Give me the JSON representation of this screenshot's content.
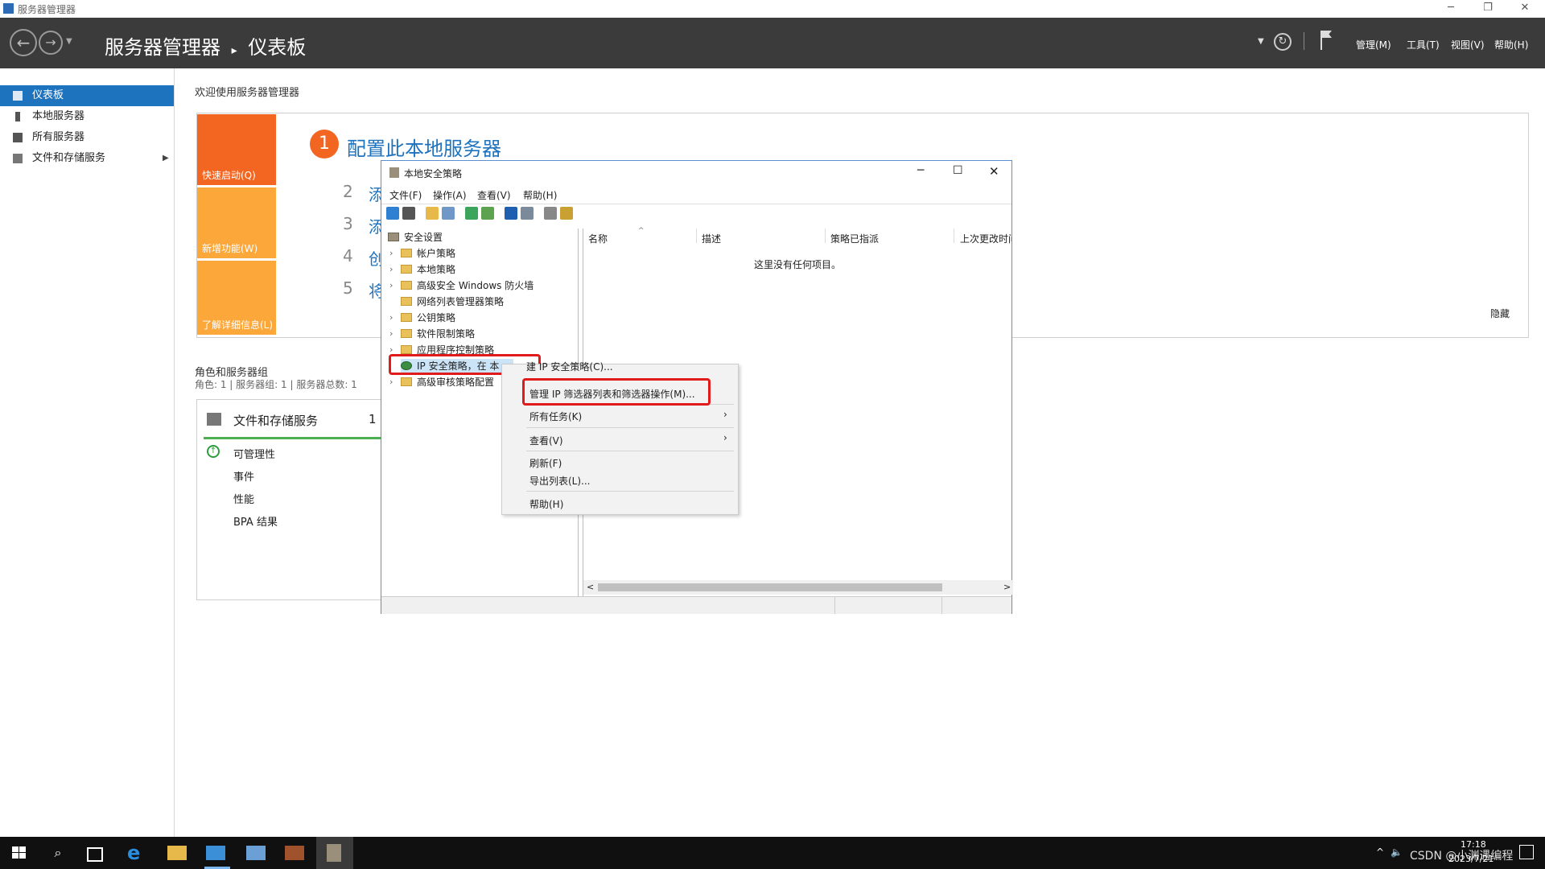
{
  "window": {
    "title": "服务器管理器",
    "controls": [
      "─",
      "❐",
      "✕"
    ]
  },
  "header": {
    "breadcrumb_root": "服务器管理器",
    "breadcrumb_sep": "▸",
    "breadcrumb_page": "仪表板",
    "menus": [
      "管理(M)",
      "工具(T)",
      "视图(V)",
      "帮助(H)"
    ]
  },
  "sidebar": {
    "items": [
      {
        "label": "仪表板",
        "icon": "dashboard-icon",
        "active": true
      },
      {
        "label": "本地服务器",
        "icon": "server-icon"
      },
      {
        "label": "所有服务器",
        "icon": "servers-icon"
      },
      {
        "label": "文件和存储服务",
        "icon": "storage-icon",
        "has_arrow": true
      }
    ]
  },
  "welcome": {
    "title": "欢迎使用服务器管理器",
    "tiles": [
      "快速启动(Q)",
      "新增功能(W)",
      "了解详细信息(L)"
    ],
    "step1": {
      "num": "1",
      "label": "配置此本地服务器"
    },
    "steps": [
      {
        "num": "2",
        "label": "添"
      },
      {
        "num": "3",
        "label": "添"
      },
      {
        "num": "4",
        "label": "创"
      },
      {
        "num": "5",
        "label": "将"
      }
    ],
    "hide": "隐藏"
  },
  "roles": {
    "title": "角色和服务器组",
    "summary": "角色: 1 | 服务器组: 1 | 服务器总数: 1",
    "card": {
      "name": "文件和存储服务",
      "count": "1",
      "rows": [
        "可管理性",
        "事件",
        "性能",
        "BPA 结果"
      ]
    }
  },
  "lsp": {
    "title": "本地安全策略",
    "menus": [
      "文件(F)",
      "操作(A)",
      "查看(V)",
      "帮助(H)"
    ],
    "tree_root": "安全设置",
    "tree": [
      {
        "label": "帐户策略",
        "arrow": true
      },
      {
        "label": "本地策略",
        "arrow": true
      },
      {
        "label": "高级安全 Windows 防火墙",
        "arrow": true
      },
      {
        "label": "网络列表管理器策略",
        "arrow": false
      },
      {
        "label": "公钥策略",
        "arrow": true
      },
      {
        "label": "软件限制策略",
        "arrow": true
      },
      {
        "label": "应用程序控制策略",
        "arrow": true
      },
      {
        "label": "IP 安全策略，在 本",
        "arrow": false,
        "selected": true
      },
      {
        "label": "高级审核策略配置",
        "arrow": true
      }
    ],
    "columns": [
      "名称",
      "描述",
      "策略已指派",
      "上次更改时间"
    ],
    "empty": "这里没有任何项目。"
  },
  "context_menu": {
    "partial_top": "建 IP 安全策略(C)...",
    "items": [
      {
        "label": "管理 IP 筛选器列表和筛选器操作(M)...",
        "highlight": true
      },
      {
        "label": "所有任务(K)",
        "submenu": true
      },
      {
        "label": "查看(V)",
        "submenu": true
      },
      {
        "label": "刷新(F)"
      },
      {
        "label": "导出列表(L)..."
      },
      {
        "label": "帮助(H)"
      }
    ]
  },
  "taskbar": {
    "time": "17:18",
    "date": "2023/7/21",
    "watermark": "CSDN @小渊遇编程"
  },
  "colors": {
    "header": "#3b3b3b",
    "accent": "#1e73be",
    "orange": "#f26622",
    "tile_light": "#fba73a",
    "highlight_red": "#e11b1b"
  }
}
